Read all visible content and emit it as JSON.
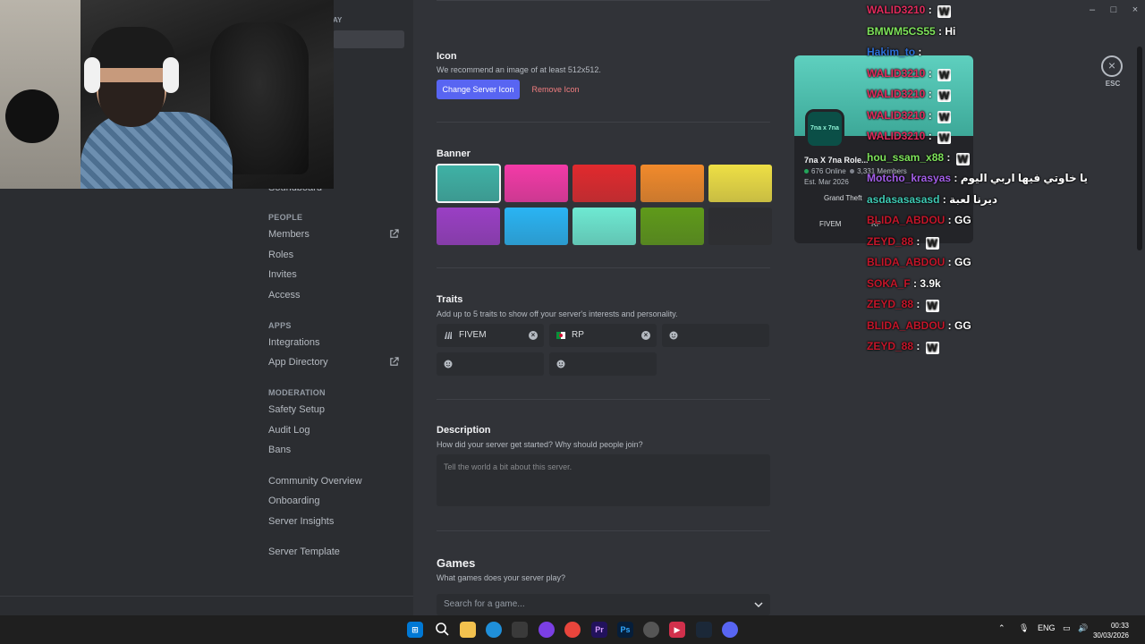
{
  "sidebar": {
    "partial_header": "AY",
    "partial_item": "Soundboard",
    "sections": [
      {
        "header": "PEOPLE",
        "items": [
          "Members",
          "Roles",
          "Invites",
          "Access"
        ]
      },
      {
        "header": "APPS",
        "items": [
          "Integrations",
          "App Directory"
        ]
      },
      {
        "header": "MODERATION",
        "items": [
          "Safety Setup",
          "Audit Log",
          "Bans"
        ]
      }
    ],
    "extra_items": [
      "Community Overview",
      "Onboarding",
      "Server Insights",
      "Server Template"
    ]
  },
  "icon_section": {
    "title": "Icon",
    "subtitle": "We recommend an image of at least 512x512.",
    "change_button": "Change Server Icon",
    "remove_button": "Remove Icon"
  },
  "banner_section": {
    "title": "Banner",
    "colors": [
      "#3fb2a6",
      "#f33aa7",
      "#e12a2e",
      "#f18a2b",
      "#eedf45",
      "#9a3fc4",
      "#2ab4f3",
      "#6ee9d2",
      "#5f9a1a",
      "#2d2e31"
    ],
    "selected_index": 0
  },
  "traits_section": {
    "title": "Traits",
    "subtitle": "Add up to 5 traits to show off your server's interests and personality.",
    "traits": [
      {
        "label": "FIVEM",
        "icon": "fivem-icon"
      },
      {
        "label": "RP",
        "icon": "algeria-flag-icon"
      }
    ]
  },
  "description_section": {
    "title": "Description",
    "subtitle": "How did your server get started? Why should people join?",
    "placeholder": "Tell the world a bit about this server."
  },
  "games_section": {
    "title": "Games",
    "subtitle": "What games does your server play?",
    "placeholder": "Search for a game..."
  },
  "preview": {
    "logo_text": "7na x 7na",
    "name": "7na X 7na Role...",
    "online": "676 Online",
    "members": "3,331 Members",
    "established": "Est. Mar 2026",
    "tag1": "Grand Theft",
    "tag2": "FIVEM",
    "tag3": "RP"
  },
  "chat": [
    {
      "user": "WALID3210",
      "msg": "",
      "w": true,
      "color": "#e02b5c"
    },
    {
      "user": "BMWM5CS55",
      "msg": "Hi",
      "w": false,
      "color": "#7ee35a"
    },
    {
      "user": "Hakim_to",
      "msg": "",
      "w": false,
      "color": "#2c6fd6"
    },
    {
      "user": "WALID3210",
      "msg": "",
      "w": true,
      "color": "#e02b5c"
    },
    {
      "user": "WALID3210",
      "msg": "",
      "w": true,
      "color": "#e02b5c"
    },
    {
      "user": "WALID3210",
      "msg": "",
      "w": true,
      "color": "#e02b5c"
    },
    {
      "user": "WALID3210",
      "msg": "",
      "w": true,
      "color": "#e02b5c"
    },
    {
      "user": "hou_ssam_x88",
      "msg": "",
      "w": true,
      "color": "#7ee35a"
    },
    {
      "user": "Motcho_krasyas",
      "msg": "يا خاوتي فيها اربي اليوم",
      "w": false,
      "color": "#a35ee8"
    },
    {
      "user": "asdasasasasd",
      "msg": "ديرنا لعبة",
      "w": false,
      "color": "#3ec9b3"
    },
    {
      "user": "BLIDA_ABDOU",
      "msg": "GG",
      "w": false,
      "color": "#c4162a"
    },
    {
      "user": "ZEYD_88",
      "msg": "",
      "w": true,
      "color": "#c4162a"
    },
    {
      "user": "BLIDA_ABDOU",
      "msg": "GG",
      "w": false,
      "color": "#c4162a"
    },
    {
      "user": "SOKA_F",
      "msg": "3.9k",
      "w": false,
      "color": "#c4162a"
    },
    {
      "user": "ZEYD_88",
      "msg": "",
      "w": true,
      "color": "#c4162a"
    },
    {
      "user": "BLIDA_ABDOU",
      "msg": "GG",
      "w": false,
      "color": "#c4162a"
    },
    {
      "user": "ZEYD_88",
      "msg": "",
      "w": true,
      "color": "#c4162a"
    }
  ],
  "esc_label": "ESC",
  "taskbar": {
    "lang": "ENG",
    "time": "00:33",
    "date": "30/03/2026"
  }
}
